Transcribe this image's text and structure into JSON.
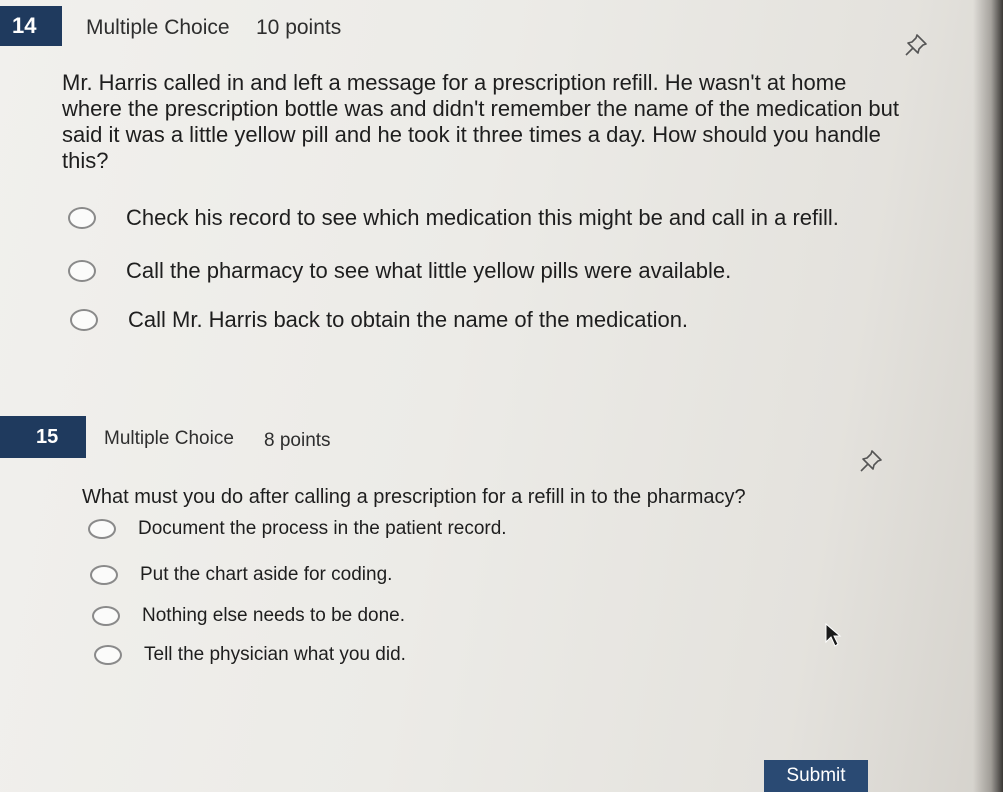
{
  "questions": [
    {
      "number": "14",
      "type": "Multiple Choice",
      "points": "10 points",
      "text": "Mr. Harris called in and left a message for a prescription refill. He wasn't at home where the prescription bottle was and didn't remember the name of the medication but said it was a little yellow pill and he took it three times a day. How should you handle this?",
      "options": [
        "Check his record to see which medication this might be and call in a refill.",
        "Call the pharmacy to see what little yellow pills were available.",
        "Call Mr. Harris back to obtain the name of the medication."
      ]
    },
    {
      "number": "15",
      "type": "Multiple Choice",
      "points": "8 points",
      "text": "What must you do after calling a prescription for a refill in to the pharmacy?",
      "options": [
        "Document the process in the patient record.",
        "Put the chart aside for coding.",
        "Nothing else needs to be done.",
        "Tell the physician what you did."
      ]
    }
  ],
  "submit_label": "Submit",
  "colors": {
    "badge": "#1f3a5e",
    "submit": "#2a4a73",
    "background": "#eeede9"
  },
  "icons": [
    "pushpin-icon",
    "radio-icon",
    "cursor-icon"
  ]
}
